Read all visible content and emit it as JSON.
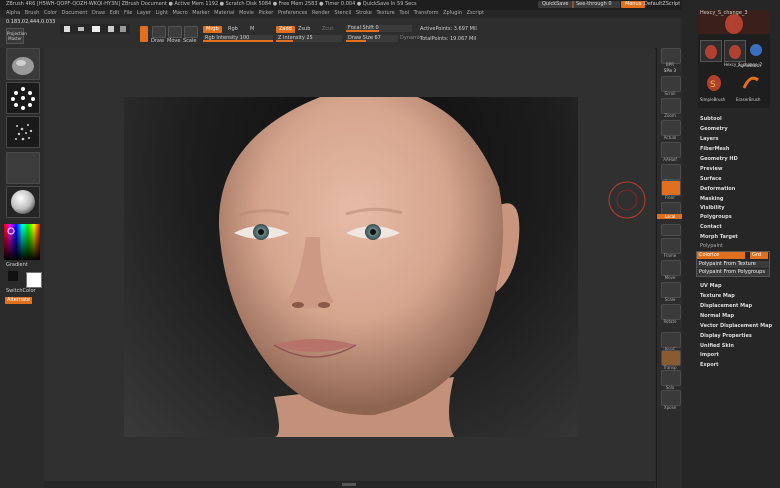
{
  "titlebar": {
    "title": "ZBrush 4R6  [H5WH-QOPF-QOZH-WKQI-HY3N]   ZBrush Document     ● Active Mem 1192 ● Scratch Disk 5084 ● Free Mem 2583 ● Timer 0.004 ● QuickSave In 59 Secs",
    "quicksave": "QuickSave",
    "seethrough": "See-through  0",
    "seethrough_level": 0.05,
    "menus": "Menus",
    "defaultzscript": "DefaultZScript"
  },
  "menubar": {
    "items": [
      "Alpha",
      "Brush",
      "Color",
      "Document",
      "Draw",
      "Edit",
      "File",
      "Layer",
      "Light",
      "Macro",
      "Marker",
      "Material",
      "Movie",
      "Picker",
      "Preferences",
      "Render",
      "Stencil",
      "Stroke",
      "Texture",
      "Tool",
      "Transform",
      "Zplugin",
      "Zscript"
    ]
  },
  "topshelf": {
    "projection_master": "Projection Master",
    "coords": "0.183,02,444,0.033",
    "edit": "Edit",
    "draw": "Draw",
    "move": "Move",
    "scale": "Scale",
    "rotate": "Rotate",
    "mrgb": "Mrgb",
    "rgb": "Rgb",
    "m": "M",
    "rgb_intensity": "Rgb Intensity 100",
    "zadd": "Zadd",
    "zsub": "Zsub",
    "zcut": "Zcut",
    "z_intensity": "Z Intensity 25",
    "focal_shift": "Focal Shift 0",
    "draw_size": "Draw Size 67",
    "dynamic": "Dynamic",
    "active_points": "ActivePoints: 3.697 Mil",
    "total_points": "TotalPoints: 19.067 Mil"
  },
  "lefttray": {
    "gradient": "Gradient",
    "switchcolor": "SwitchColor",
    "alternate": "Alternate"
  },
  "righttoolbar": {
    "bpr": "BPR",
    "spix": "SPix 3",
    "scroll": "Scroll",
    "zoom": "Zoom",
    "actual": "Actual",
    "aahalf": "AAHalf",
    "persp": "Persp",
    "floor": "Floor",
    "local": "Local",
    "frame": "Frame",
    "move": "Move",
    "scale": "Scale",
    "rotate": "Rotate",
    "polyf": "PolyF",
    "transp": "Transp",
    "solo": "Solo",
    "xpose": "Xpose"
  },
  "righttray": {
    "tool_name": "Hexcy_S_change_3",
    "tool_name_2": "Hexcy_S_change_2",
    "simple_brush": "SimpleBrush",
    "eraser_brush": "EraserBrush",
    "alpha_brush": "AlphaBrush",
    "menus_top": [
      "Subtool",
      "Geometry",
      "Layers",
      "FiberMesh",
      "Geometry HD",
      "Preview",
      "Surface",
      "Deformation",
      "Masking",
      "Visibility",
      "Polygroups",
      "Contact",
      "Morph Target"
    ],
    "polypaint_header": "Polypaint",
    "colorize": "Colorize",
    "grd": "Grd",
    "polypaint_from_texture": "Polypaint From Texture",
    "polypaint_from_polygroups": "Polypaint From Polygroups",
    "menus_bottom": [
      "UV Map",
      "Texture Map",
      "Displacement Map",
      "Normal Map",
      "Vector Displacement Map",
      "Display Properties",
      "Unified Skin",
      "Import",
      "Export"
    ]
  },
  "colors": {
    "accent": "#e0701e",
    "background": "#2b2b2b"
  }
}
